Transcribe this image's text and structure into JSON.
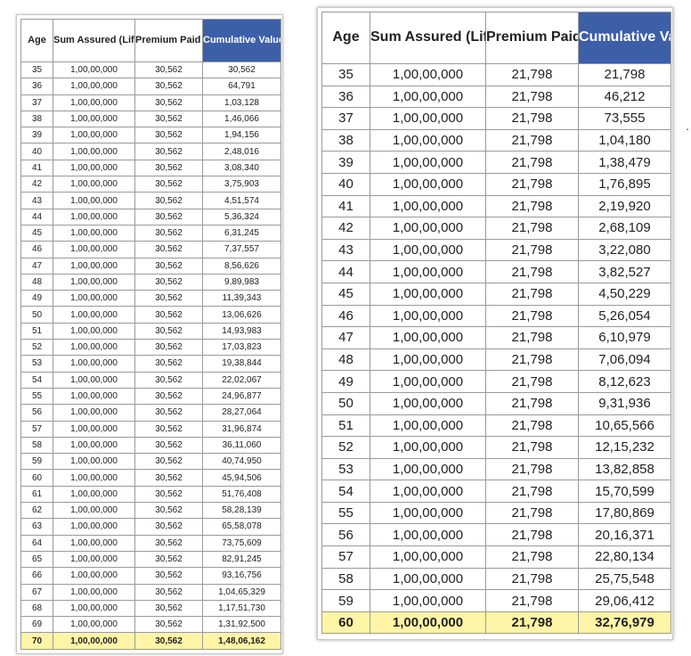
{
  "left_table": {
    "headers": [
      "Age",
      "Sum Assured (Life Cover)",
      "Premium Paid in year",
      "Cumulative Value Paid"
    ],
    "rows": [
      [
        "35",
        "1,00,00,000",
        "30,562",
        "30,562"
      ],
      [
        "36",
        "1,00,00,000",
        "30,562",
        "64,791"
      ],
      [
        "37",
        "1,00,00,000",
        "30,562",
        "1,03,128"
      ],
      [
        "38",
        "1,00,00,000",
        "30,562",
        "1,46,066"
      ],
      [
        "39",
        "1,00,00,000",
        "30,562",
        "1,94,156"
      ],
      [
        "40",
        "1,00,00,000",
        "30,562",
        "2,48,016"
      ],
      [
        "41",
        "1,00,00,000",
        "30,562",
        "3,08,340"
      ],
      [
        "42",
        "1,00,00,000",
        "30,562",
        "3,75,903"
      ],
      [
        "43",
        "1,00,00,000",
        "30,562",
        "4,51,574"
      ],
      [
        "44",
        "1,00,00,000",
        "30,562",
        "5,36,324"
      ],
      [
        "45",
        "1,00,00,000",
        "30,562",
        "6,31,245"
      ],
      [
        "46",
        "1,00,00,000",
        "30,562",
        "7,37,557"
      ],
      [
        "47",
        "1,00,00,000",
        "30,562",
        "8,56,626"
      ],
      [
        "48",
        "1,00,00,000",
        "30,562",
        "9,89,983"
      ],
      [
        "49",
        "1,00,00,000",
        "30,562",
        "11,39,343"
      ],
      [
        "50",
        "1,00,00,000",
        "30,562",
        "13,06,626"
      ],
      [
        "51",
        "1,00,00,000",
        "30,562",
        "14,93,983"
      ],
      [
        "52",
        "1,00,00,000",
        "30,562",
        "17,03,823"
      ],
      [
        "53",
        "1,00,00,000",
        "30,562",
        "19,38,844"
      ],
      [
        "54",
        "1,00,00,000",
        "30,562",
        "22,02,067"
      ],
      [
        "55",
        "1,00,00,000",
        "30,562",
        "24,96,877"
      ],
      [
        "56",
        "1,00,00,000",
        "30,562",
        "28,27,064"
      ],
      [
        "57",
        "1,00,00,000",
        "30,562",
        "31,96,874"
      ],
      [
        "58",
        "1,00,00,000",
        "30,562",
        "36,11,060"
      ],
      [
        "59",
        "1,00,00,000",
        "30,562",
        "40,74,950"
      ],
      [
        "60",
        "1,00,00,000",
        "30,562",
        "45,94,506"
      ],
      [
        "61",
        "1,00,00,000",
        "30,562",
        "51,76,408"
      ],
      [
        "62",
        "1,00,00,000",
        "30,562",
        "58,28,139"
      ],
      [
        "63",
        "1,00,00,000",
        "30,562",
        "65,58,078"
      ],
      [
        "64",
        "1,00,00,000",
        "30,562",
        "73,75,609"
      ],
      [
        "65",
        "1,00,00,000",
        "30,562",
        "82,91,245"
      ],
      [
        "66",
        "1,00,00,000",
        "30,562",
        "93,16,756"
      ],
      [
        "67",
        "1,00,00,000",
        "30,562",
        "1,04,65,329"
      ],
      [
        "68",
        "1,00,00,000",
        "30,562",
        "1,17,51,730"
      ],
      [
        "69",
        "1,00,00,000",
        "30,562",
        "1,31,92,500"
      ]
    ],
    "total_row": [
      "70",
      "1,00,00,000",
      "30,562",
      "1,48,06,162"
    ]
  },
  "right_table": {
    "headers": [
      "Age",
      "Sum Assured (Life Cover)",
      "Premium Paid in year",
      "Cumulative Value Paid"
    ],
    "rows": [
      [
        "35",
        "1,00,00,000",
        "21,798",
        "21,798"
      ],
      [
        "36",
        "1,00,00,000",
        "21,798",
        "46,212"
      ],
      [
        "37",
        "1,00,00,000",
        "21,798",
        "73,555"
      ],
      [
        "38",
        "1,00,00,000",
        "21,798",
        "1,04,180"
      ],
      [
        "39",
        "1,00,00,000",
        "21,798",
        "1,38,479"
      ],
      [
        "40",
        "1,00,00,000",
        "21,798",
        "1,76,895"
      ],
      [
        "41",
        "1,00,00,000",
        "21,798",
        "2,19,920"
      ],
      [
        "42",
        "1,00,00,000",
        "21,798",
        "2,68,109"
      ],
      [
        "43",
        "1,00,00,000",
        "21,798",
        "3,22,080"
      ],
      [
        "44",
        "1,00,00,000",
        "21,798",
        "3,82,527"
      ],
      [
        "45",
        "1,00,00,000",
        "21,798",
        "4,50,229"
      ],
      [
        "46",
        "1,00,00,000",
        "21,798",
        "5,26,054"
      ],
      [
        "47",
        "1,00,00,000",
        "21,798",
        "6,10,979"
      ],
      [
        "48",
        "1,00,00,000",
        "21,798",
        "7,06,094"
      ],
      [
        "49",
        "1,00,00,000",
        "21,798",
        "8,12,623"
      ],
      [
        "50",
        "1,00,00,000",
        "21,798",
        "9,31,936"
      ],
      [
        "51",
        "1,00,00,000",
        "21,798",
        "10,65,566"
      ],
      [
        "52",
        "1,00,00,000",
        "21,798",
        "12,15,232"
      ],
      [
        "53",
        "1,00,00,000",
        "21,798",
        "13,82,858"
      ],
      [
        "54",
        "1,00,00,000",
        "21,798",
        "15,70,599"
      ],
      [
        "55",
        "1,00,00,000",
        "21,798",
        "17,80,869"
      ],
      [
        "56",
        "1,00,00,000",
        "21,798",
        "20,16,371"
      ],
      [
        "57",
        "1,00,00,000",
        "21,798",
        "22,80,134"
      ],
      [
        "58",
        "1,00,00,000",
        "21,798",
        "25,75,548"
      ],
      [
        "59",
        "1,00,00,000",
        "21,798",
        "29,06,412"
      ]
    ],
    "total_row": [
      "60",
      "1,00,00,000",
      "21,798",
      "32,76,979"
    ]
  },
  "colors": {
    "header_highlight": "#3d5fa7",
    "total_row_highlight": "#fff5a6"
  },
  "side_mark": "."
}
